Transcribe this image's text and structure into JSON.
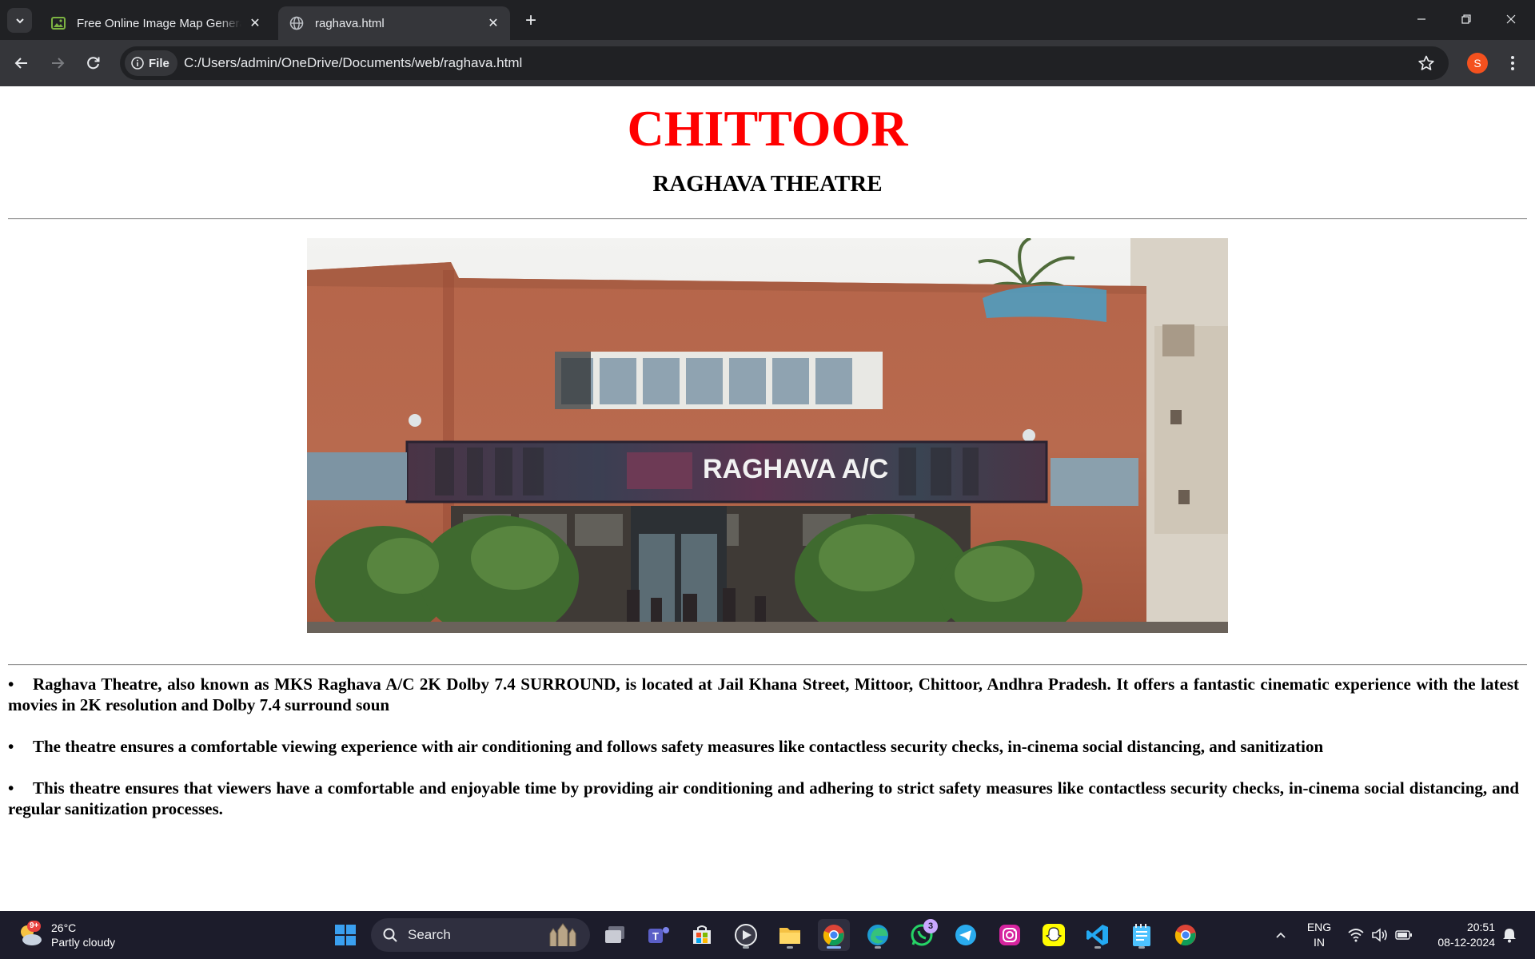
{
  "browser": {
    "tabs": [
      {
        "title": "Free Online Image Map Genera",
        "favicon": "image-map-favicon",
        "active": false
      },
      {
        "title": "raghava.html",
        "favicon": "globe-icon",
        "active": true
      }
    ],
    "omnibox": {
      "chip_label": "File",
      "url": "C:/Users/admin/OneDrive/Documents/web/raghava.html"
    },
    "profile_initial": "S"
  },
  "page": {
    "heading": "CHITTOOR",
    "subheading": "RAGHAVA THEATRE",
    "image": {
      "description": "Raghava Theatre building exterior",
      "sign_text": "RAGHAVA A/C"
    },
    "bullet_char": "•",
    "bullets": [
      "Raghava Theatre, also known as MKS Raghava A/C 2K Dolby 7.4 SURROUND, is located at Jail Khana Street, Mittoor, Chittoor, Andhra Pradesh. It offers a fantastic cinematic experience with the latest movies in 2K resolution and Dolby 7.4 surround soun",
      "The theatre ensures a comfortable viewing experience with air conditioning and follows safety measures like contactless security checks, in-cinema social distancing, and sanitization",
      "This theatre ensures that viewers have a comfortable and enjoyable time by providing air conditioning and adhering to strict safety measures like contactless security checks, in-cinema social distancing, and regular sanitization processes."
    ],
    "colors": {
      "heading": "#ff0000",
      "text": "#000000",
      "background": "#ffffff"
    }
  },
  "taskbar": {
    "weather": {
      "temp": "26°C",
      "condition": "Partly cloudy",
      "badge": "9+"
    },
    "search_label": "Search",
    "apps": [
      {
        "name": "start-button"
      },
      {
        "name": "task-view"
      },
      {
        "name": "teams"
      },
      {
        "name": "microsoft-store"
      },
      {
        "name": "media-player"
      },
      {
        "name": "file-explorer"
      },
      {
        "name": "chrome",
        "active": true
      },
      {
        "name": "edge"
      },
      {
        "name": "whatsapp",
        "badge": "3"
      },
      {
        "name": "telegram"
      },
      {
        "name": "instagram"
      },
      {
        "name": "snapchat"
      },
      {
        "name": "vscode"
      },
      {
        "name": "notepad"
      },
      {
        "name": "chrome-2"
      }
    ],
    "tray": {
      "language_top": "ENG",
      "language_bottom": "IN",
      "time": "20:51",
      "date": "08-12-2024"
    }
  }
}
